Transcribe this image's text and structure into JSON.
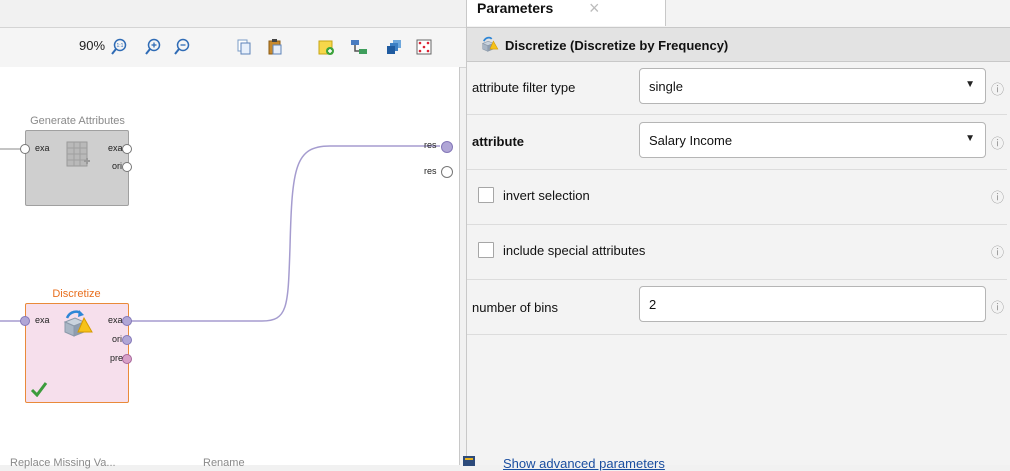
{
  "canvas": {
    "zoom_label": "90%",
    "toolbar_icons": [
      "zoom-reset-icon",
      "zoom-in-icon",
      "zoom-out-icon",
      "copy-icon",
      "paste-icon",
      "add-note-icon",
      "auto-wire-icon",
      "arrange-icon",
      "fit-icon"
    ],
    "operators": {
      "generate_attributes": {
        "title": "Generate Attributes",
        "input_port": "exa",
        "output_ports": [
          "exa",
          "ori"
        ]
      },
      "discretize": {
        "title": "Discretize",
        "input_port": "exa",
        "output_ports": [
          "exa",
          "ori",
          "pre"
        ],
        "title_color": "#e86f1e"
      }
    },
    "result_ports": [
      "res",
      "res"
    ],
    "bottom_labels": [
      "Replace Missing Va...",
      "Rename"
    ]
  },
  "params": {
    "tab_label": "Parameters",
    "tab_close": "×",
    "header": "Discretize (Discretize by Frequency)",
    "rows": [
      {
        "label": "attribute filter type",
        "value": "single",
        "type": "select"
      },
      {
        "label": "attribute",
        "value": "Salary Income",
        "type": "select"
      },
      {
        "label": "invert selection",
        "type": "checkbox",
        "checked": false
      },
      {
        "label": "include special attributes",
        "type": "checkbox",
        "checked": false
      },
      {
        "label": "number of bins",
        "value": "2",
        "type": "text"
      }
    ],
    "info_symbol": "ⓘ",
    "advanced_link": "Show advanced parameters"
  }
}
